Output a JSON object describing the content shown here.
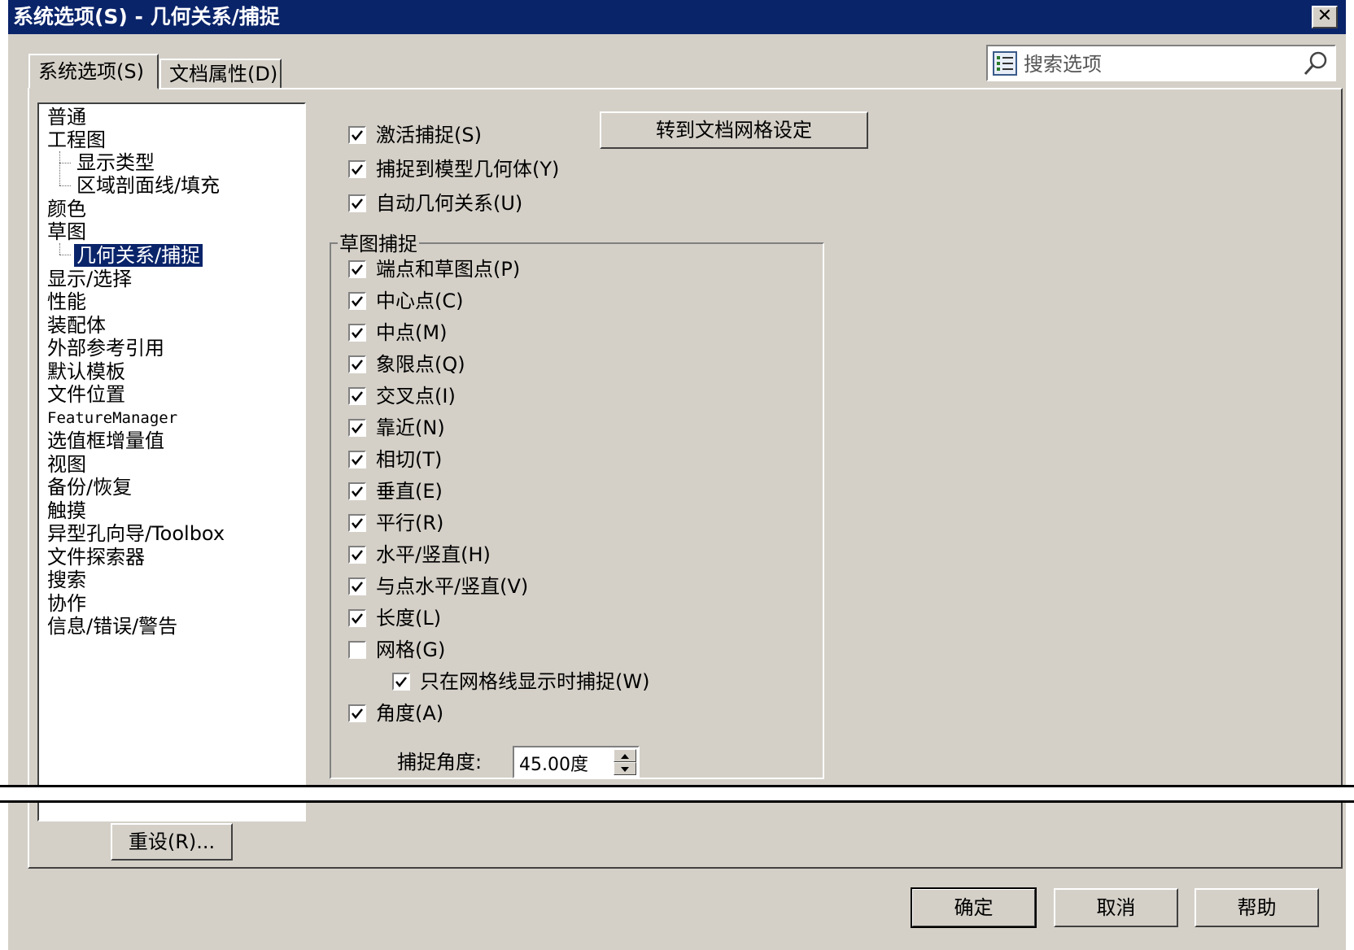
{
  "window": {
    "title": "系统选项(S) - 几何关系/捕捉",
    "close_glyph": "✕"
  },
  "tabs": [
    {
      "label": "系统选项(S)",
      "active": true
    },
    {
      "label": "文档属性(D)",
      "active": false
    }
  ],
  "search": {
    "placeholder": "搜索选项"
  },
  "tree": {
    "items": [
      {
        "label": "普通"
      },
      {
        "label": "工程图"
      },
      {
        "label": "显示类型"
      },
      {
        "label": "区域剖面线/填充"
      },
      {
        "label": "颜色"
      },
      {
        "label": "草图"
      },
      {
        "label": "几何关系/捕捉",
        "selected": true
      },
      {
        "label": "显示/选择"
      },
      {
        "label": "性能"
      },
      {
        "label": "装配体"
      },
      {
        "label": "外部参考引用"
      },
      {
        "label": "默认模板"
      },
      {
        "label": "文件位置"
      },
      {
        "label": "FeatureManager"
      },
      {
        "label": "选值框增量值"
      },
      {
        "label": "视图"
      },
      {
        "label": "备份/恢复"
      },
      {
        "label": "触摸"
      },
      {
        "label": "异型孔向导/Toolbox"
      },
      {
        "label": "文件探索器"
      },
      {
        "label": "搜索"
      },
      {
        "label": "协作"
      },
      {
        "label": "信息/错误/警告"
      }
    ]
  },
  "main": {
    "goto_grid_button": "转到文档网格设定",
    "top_options": [
      {
        "label": "激活捕捉(S)",
        "checked": true
      },
      {
        "label": "捕捉到模型几何体(Y)",
        "checked": true
      },
      {
        "label": "自动几何关系(U)",
        "checked": true
      }
    ],
    "sketch_snaps": {
      "title": "草图捕捉",
      "options": [
        {
          "label": "端点和草图点(P)",
          "checked": true
        },
        {
          "label": "中心点(C)",
          "checked": true
        },
        {
          "label": "中点(M)",
          "checked": true
        },
        {
          "label": "象限点(Q)",
          "checked": true
        },
        {
          "label": "交叉点(I)",
          "checked": true
        },
        {
          "label": "靠近(N)",
          "checked": true
        },
        {
          "label": "相切(T)",
          "checked": true
        },
        {
          "label": "垂直(E)",
          "checked": true
        },
        {
          "label": "平行(R)",
          "checked": true
        },
        {
          "label": "水平/竖直(H)",
          "checked": true
        },
        {
          "label": "与点水平/竖直(V)",
          "checked": true
        },
        {
          "label": "长度(L)",
          "checked": true
        },
        {
          "label": "网格(G)",
          "checked": false
        },
        {
          "label": "只在网格线显示时捕捉(W)",
          "checked": true
        },
        {
          "label": "角度(A)",
          "checked": true
        }
      ],
      "snap_angle_label": "捕捉角度:",
      "snap_angle_value": "45.00度"
    }
  },
  "reset_button": "重设(R)...",
  "footer": {
    "ok": "确定",
    "cancel": "取消",
    "help": "帮助"
  }
}
